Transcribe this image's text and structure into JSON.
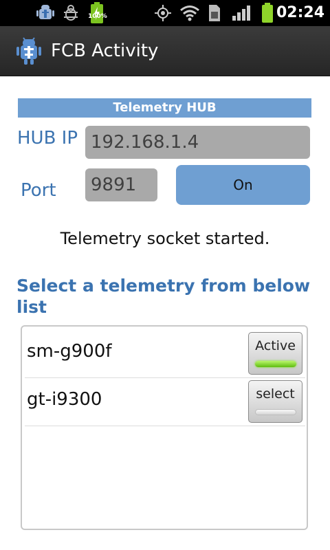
{
  "status_bar": {
    "battery_percent": "100%",
    "time": "02:24",
    "icons": [
      "android-debug-icon",
      "bug-icon",
      "battery-charging-icon",
      "gps-icon",
      "wifi-icon",
      "sim-icon",
      "signal-icon",
      "battery-icon"
    ]
  },
  "app": {
    "title": "FCB Activity"
  },
  "hub": {
    "header": "Telemetry HUB",
    "ip_label": "HUB IP",
    "ip_value": "192.168.1.4",
    "port_label": "Port",
    "port_value": "9891",
    "toggle_label": "On"
  },
  "status_message": "Telemetry socket started.",
  "list_title": "Select a telemetry from below list",
  "devices": [
    {
      "name": "sm-g900f",
      "button_label": "Active",
      "active": true
    },
    {
      "name": "gt-i9300",
      "button_label": "select",
      "active": false
    }
  ],
  "colors": {
    "accent": "#6f9fd2",
    "label_blue": "#3b73b0",
    "active_led": "#5fbd10"
  }
}
